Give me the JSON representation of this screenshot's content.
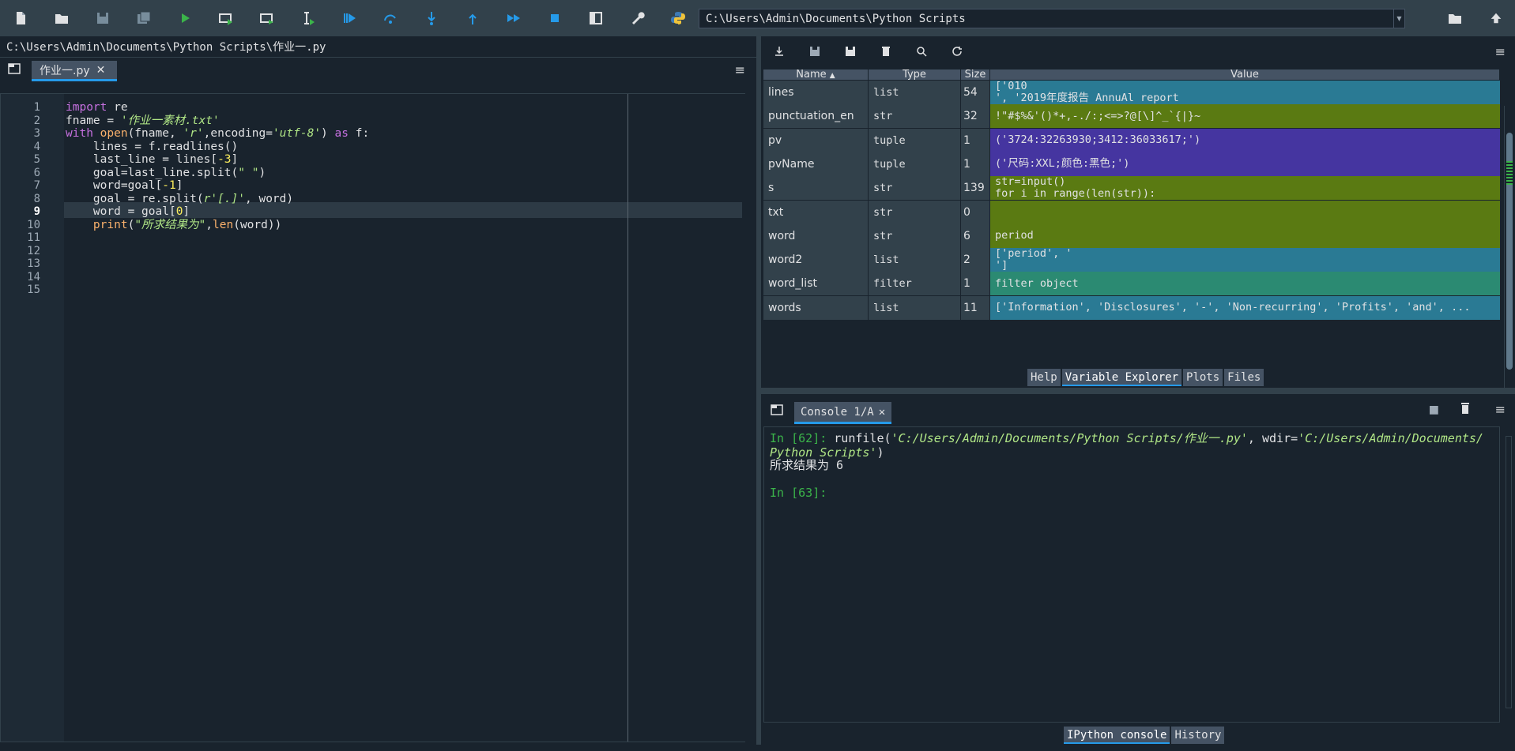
{
  "toolbar": {
    "buttons": [
      "new-file",
      "open-file",
      "save-file",
      "save-all",
      "run",
      "run-cell",
      "run-cell-advance",
      "run-selection",
      "debug",
      "step",
      "step-into",
      "step-return",
      "continue",
      "stop",
      "maximize-pane",
      "preferences",
      "python-path-manager"
    ],
    "working_dir": "C:\\Users\\Admin\\Documents\\Python Scripts"
  },
  "editor": {
    "file_path": "C:\\Users\\Admin\\Documents\\Python Scripts\\作业一.py",
    "tab_label": "作业一.py",
    "close_glyph": "✕",
    "menu_glyph": "≡",
    "current_line": 9,
    "line_numbers": [
      "1",
      "2",
      "3",
      "4",
      "5",
      "6",
      "7",
      "8",
      "9",
      "10",
      "11",
      "12",
      "13",
      "14",
      "15"
    ]
  },
  "variable_explorer": {
    "headers": {
      "name": "Name",
      "type": "Type",
      "size": "Size",
      "value": "Value"
    },
    "rows": [
      {
        "name": "lines",
        "type": "list",
        "size": "54",
        "value": "['010\n', '2019年度报告 AnnuAl report",
        "color": "#2a7a94"
      },
      {
        "name": "punctuation_en",
        "type": "str",
        "size": "32",
        "value": "!\"#$%&'()*+,-./:;<=>?@[\\]^_`{|}~",
        "color": "#5a7a12"
      },
      {
        "name": "pv",
        "type": "tuple",
        "size": "1",
        "value": "('3724:32263930;3412:36033617;')",
        "color": "#4535a0"
      },
      {
        "name": "pvName",
        "type": "tuple",
        "size": "1",
        "value": "('尺码:XXL;颜色:黑色;')",
        "color": "#4535a0"
      },
      {
        "name": "s",
        "type": "str",
        "size": "139",
        "value": "str=input()\nfor i in range(len(str)):",
        "color": "#5a7a12"
      },
      {
        "name": "txt",
        "type": "str",
        "size": "0",
        "value": "",
        "color": "#5a7a12"
      },
      {
        "name": "word",
        "type": "str",
        "size": "6",
        "value": "period",
        "color": "#5a7a12"
      },
      {
        "name": "word2",
        "type": "list",
        "size": "2",
        "value": "['period', '\n']",
        "color": "#2a7a94"
      },
      {
        "name": "word_list",
        "type": "filter",
        "size": "1",
        "value": "filter object",
        "color": "#2b8a72"
      },
      {
        "name": "words",
        "type": "list",
        "size": "11",
        "value": "['Information', 'Disclosures', '-', 'Non-recurring', 'Profits', 'and', ...",
        "color": "#2a7a94"
      }
    ],
    "bottom_tabs": [
      "Help",
      "Variable Explorer",
      "Plots",
      "Files"
    ],
    "active_tab": "Variable Explorer"
  },
  "console": {
    "tab_label": "Console 1/A",
    "close_glyph": "✕",
    "lines": {
      "in62_prompt": "In [",
      "in62_num": "62",
      "in62_end": "]: ",
      "in62_call": "runfile(",
      "in62_arg1": "'C:/Users/Admin/Documents/Python Scripts/作业一.py'",
      "in62_sep": ", wdir=",
      "in62_arg2a": "'C:/Users/Admin/Documents/",
      "in62_arg2b": "Python Scripts'",
      "in62_close": ")",
      "output": "所求结果为 6",
      "in63_prompt": "In [",
      "in63_num": "63",
      "in63_end": "]:"
    },
    "bottom_tabs": [
      "IPython console",
      "History"
    ],
    "active_tab": "IPython console"
  },
  "colors": {
    "background": "#19232d",
    "panel": "#32414b",
    "accent": "#259ae9",
    "prompt_green": "#3bb44a",
    "string_green": "#b0e686",
    "keyword_purple": "#c670e0"
  }
}
